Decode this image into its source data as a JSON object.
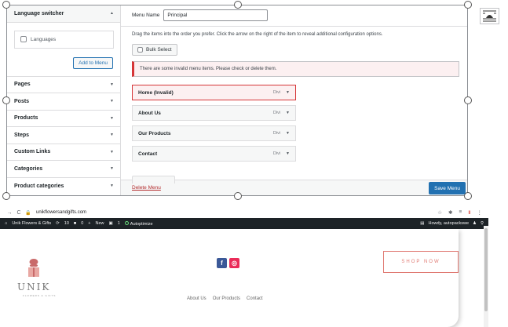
{
  "sidebar": {
    "open_section": "Language switcher",
    "languages_label": "Languages",
    "add_button": "Add to Menu",
    "sections": [
      "Pages",
      "Posts",
      "Products",
      "Steps",
      "Custom Links",
      "Categories",
      "Product categories"
    ]
  },
  "menu": {
    "name_label": "Menu Name",
    "name_value": "Principal",
    "instructions": "Drag the items into the order you prefer. Click the arrow on the right of the item to reveal additional configuration options.",
    "bulk_select": "Bulk Select",
    "notice": "There are some invalid menu items. Please check or delete them.",
    "items": [
      {
        "label": "Home (Invalid)",
        "type": "Divi"
      },
      {
        "label": "About Us",
        "type": "Divi"
      },
      {
        "label": "Our Products",
        "type": "Divi"
      },
      {
        "label": "Contact",
        "type": "Divi"
      }
    ],
    "delete_link": "Delete Menu",
    "save_button": "Save Menu"
  },
  "browser": {
    "url": "unikflowersandgifts.com"
  },
  "admin_bar": {
    "site_name": "Unik Flowers & Gifts",
    "updates": "10",
    "comments": "0",
    "new": "New",
    "count": "1",
    "plugin": "Autoptimize",
    "howdy": "Howdy, autopackswe"
  },
  "site": {
    "logo": "UNIK",
    "logo_sub": "FLOWERS & GIFTS",
    "shop_button": "SHOP NOW",
    "nav": [
      "About Us",
      "Our Products",
      "Contact"
    ]
  },
  "colors": {
    "wp_blue": "#2271b1",
    "error_red": "#d63638",
    "admin_bar": "#1d2327",
    "accent_coral": "#e07a73"
  }
}
